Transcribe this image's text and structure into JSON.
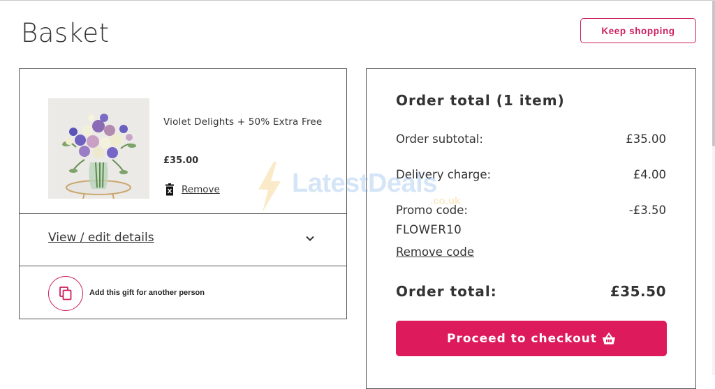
{
  "colors": {
    "accent": "#dd1a5b",
    "accent_border": "#cc1f5e",
    "text": "#333333",
    "border": "#555555"
  },
  "header": {
    "title": "Basket",
    "keep_shopping_label": "Keep shopping"
  },
  "basket": {
    "items": [
      {
        "name": "Violet Delights + 50% Extra Free",
        "price": "£35.00",
        "remove_label": "Remove",
        "image_icon": "flower-bouquet-image"
      }
    ],
    "details_label": "View / edit details",
    "gift_label": "Add this gift for another person"
  },
  "summary": {
    "title": "Order total (1 item)",
    "subtotal_label": "Order subtotal:",
    "subtotal_value": "£35.00",
    "delivery_label": "Delivery charge:",
    "delivery_value": "£4.00",
    "promo_label": "Promo code:",
    "promo_value": "-£3.50",
    "promo_code": "FLOWER10",
    "remove_code_label": "Remove code",
    "total_label": "Order total:",
    "total_value": "£35.50",
    "checkout_label": "Proceed to checkout"
  },
  "watermark": {
    "brand": "LatestDeals",
    "domain": ".co.uk"
  }
}
